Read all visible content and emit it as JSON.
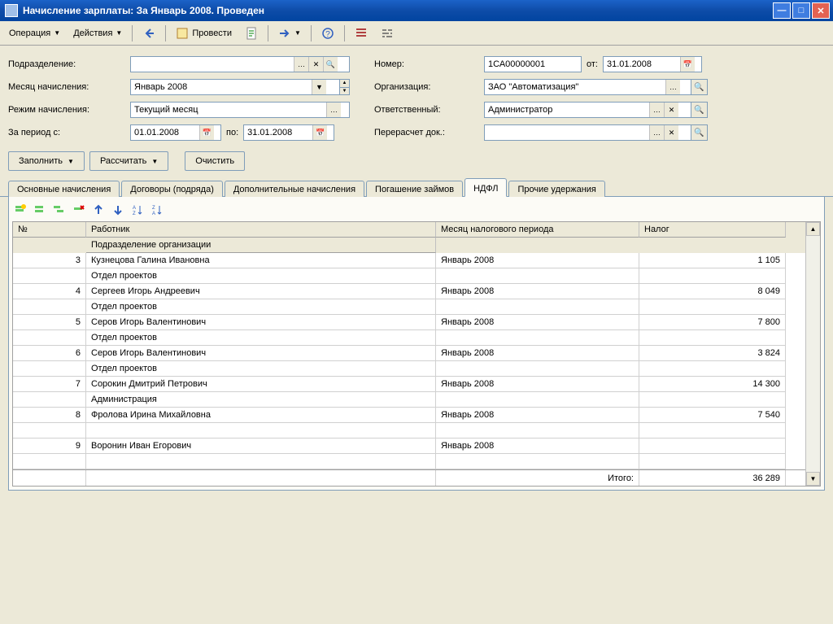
{
  "window": {
    "title": "Начисление зарплаты: За Январь 2008. Проведен"
  },
  "toolbar": {
    "operation": "Операция",
    "actions": "Действия",
    "execute": "Провести"
  },
  "form": {
    "subdivision_label": "Подразделение:",
    "subdivision_value": "",
    "month_label": "Месяц начисления:",
    "month_value": "Январь 2008",
    "mode_label": "Режим начисления:",
    "mode_value": "Текущий месяц",
    "period_from_label": "За период с:",
    "period_from": "01.01.2008",
    "period_to_label": "по:",
    "period_to": "31.01.2008",
    "number_label": "Номер:",
    "number_value": "1СА00000001",
    "date_from_label": "от:",
    "date_value": "31.01.2008",
    "org_label": "Организация:",
    "org_value": "ЗАО \"Автоматизация\"",
    "responsible_label": "Ответственный:",
    "responsible_value": "Администратор",
    "recalc_label": "Перерасчет док.:",
    "recalc_value": ""
  },
  "buttons": {
    "fill": "Заполнить",
    "calc": "Рассчитать",
    "clear": "Очистить"
  },
  "tabs": {
    "t1": "Основные начисления",
    "t2": "Договоры (подряда)",
    "t3": "Дополнительные начисления",
    "t4": "Погашение займов",
    "t5": "НДФЛ",
    "t6": "Прочие удержания"
  },
  "grid": {
    "h_num": "№",
    "h_worker": "Работник",
    "h_month": "Месяц налогового периода",
    "h_tax": "Налог",
    "h_sub": "Подразделение организации",
    "total_label": "Итого:",
    "total_value": "36 289",
    "rows": [
      {
        "n": "3",
        "worker": "Кузнецова Галина Ивановна",
        "month": "Январь 2008",
        "tax": "1 105",
        "sub": "Отдел проектов"
      },
      {
        "n": "4",
        "worker": "Сергеев Игорь Андреевич",
        "month": "Январь 2008",
        "tax": "8 049",
        "sub": "Отдел проектов"
      },
      {
        "n": "5",
        "worker": "Серов Игорь Валентинович",
        "month": "Январь 2008",
        "tax": "7 800",
        "sub": "Отдел проектов"
      },
      {
        "n": "6",
        "worker": "Серов Игорь Валентинович",
        "month": "Январь 2008",
        "tax": "3 824",
        "sub": "Отдел проектов"
      },
      {
        "n": "7",
        "worker": "Сорокин Дмитрий Петрович",
        "month": "Январь 2008",
        "tax": "14 300",
        "sub": "Администрация"
      },
      {
        "n": "8",
        "worker": "Фролова Ирина Михайловна",
        "month": "Январь 2008",
        "tax": "7 540",
        "sub": ""
      },
      {
        "n": "9",
        "worker": "Воронин Иван Егорович",
        "month": "Январь 2008",
        "tax": "",
        "sub": ""
      }
    ]
  }
}
